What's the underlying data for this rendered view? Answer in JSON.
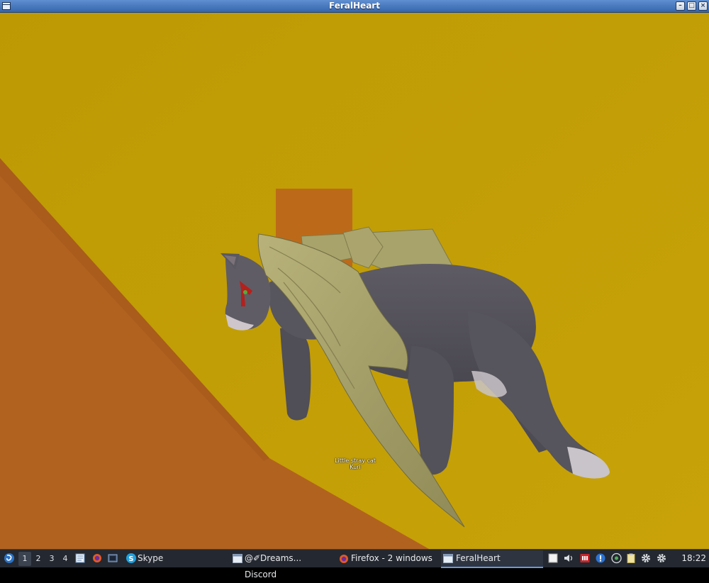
{
  "window": {
    "title": "FeralHeart"
  },
  "scene": {
    "nameplate_title": "Little  stray  cat",
    "nameplate_name": "Kuri",
    "colors": {
      "sky": "#bf9c06",
      "ramp": "#b2621f",
      "pillar": "#bc6a19",
      "fur": "#5a5860",
      "wing": "#a9a46b"
    }
  },
  "taskbar": {
    "desktops": [
      "1",
      "2",
      "3",
      "4"
    ],
    "active_desktop": "1",
    "skype_label": "Skype",
    "tasks": [
      {
        "label": "@✐Dreams... Discord",
        "icon": "window-icon"
      },
      {
        "label": "Firefox - 2 windows",
        "icon": "firefox-icon"
      },
      {
        "label": "FeralHeart",
        "icon": "window-icon",
        "active": true
      }
    ],
    "clock": "18:22"
  }
}
